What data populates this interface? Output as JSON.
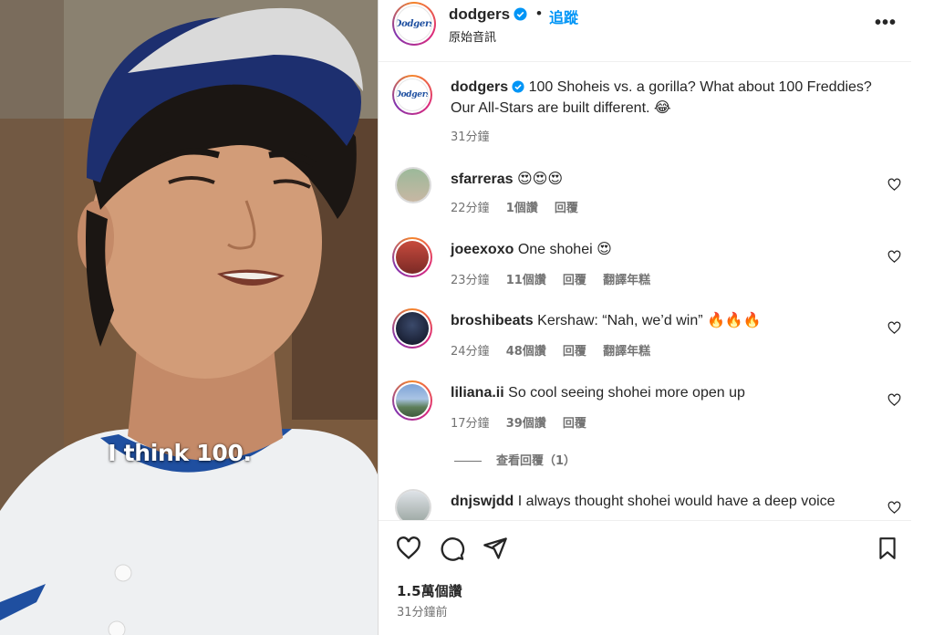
{
  "video": {
    "caption": "I think 100."
  },
  "header": {
    "username": "dodgers",
    "follow_label": "追蹤",
    "audio_label": "原始音訊",
    "more_icon": "more-horizontal-icon"
  },
  "caption_post": {
    "username": "dodgers",
    "text": "100 Shoheis vs. a gorilla? What about 100 Freddies? Our All-Stars are built different.",
    "emoji": "😂",
    "time": "31分鐘"
  },
  "comments": [
    {
      "username": "sfarreras",
      "text": "",
      "emoji": "😍😍😍",
      "time": "22分鐘",
      "likes": "1個讚",
      "reply": "回覆",
      "translate": ""
    },
    {
      "username": "joeexoxo",
      "text": "One shohei",
      "emoji": "😍",
      "time": "23分鐘",
      "likes": "11個讚",
      "reply": "回覆",
      "translate": "翻譯年糕"
    },
    {
      "username": "broshibeats",
      "text": "Kershaw: “Nah, we’d win”",
      "emoji": "🔥🔥🔥",
      "time": "24分鐘",
      "likes": "48個讚",
      "reply": "回覆",
      "translate": "翻譯年糕"
    },
    {
      "username": "liliana.ii",
      "text": "So cool seeing shohei more open up",
      "emoji": "",
      "time": "17分鐘",
      "likes": "39個讚",
      "reply": "回覆",
      "translate": ""
    },
    {
      "username": "dnjswjdd",
      "text": "I always thought shohei would have a deep voice",
      "emoji": "",
      "time": "",
      "likes": "",
      "reply": "",
      "translate": ""
    }
  ],
  "view_replies": "查看回覆（1）",
  "footer": {
    "likes": "1.5萬個讚",
    "posted": "31分鐘前"
  },
  "colors": {
    "link_blue": "#0095f6",
    "verified_blue": "#0095f6",
    "text": "#262626",
    "muted": "#737373"
  }
}
